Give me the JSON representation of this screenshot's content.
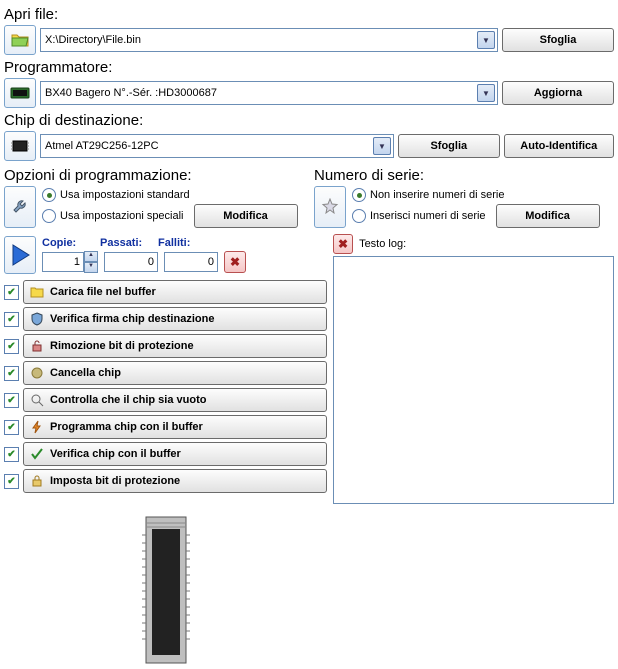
{
  "open_file": {
    "label": "Apri file:",
    "path": "X:\\Directory\\File.bin",
    "browse": "Sfoglia"
  },
  "programmer": {
    "label": "Programmatore:",
    "device": "BX40 Bagero N°.-Sér. :HD3000687",
    "refresh": "Aggiorna"
  },
  "target_chip": {
    "label": "Chip di destinazione:",
    "chip": "Atmel AT29C256-12PC",
    "browse": "Sfoglia",
    "auto": "Auto-Identifica"
  },
  "prog_options": {
    "label": "Opzioni di programmazione:",
    "opt1": "Usa impostazioni standard",
    "opt2": "Usa impostazioni speciali",
    "edit": "Modifica"
  },
  "serial": {
    "label": "Numero di serie:",
    "opt1": "Non inserire numeri di serie",
    "opt2": "Inserisci numeri di serie",
    "edit": "Modifica"
  },
  "run": {
    "copies_label": "Copie:",
    "passed_label": "Passati:",
    "failed_label": "Falliti:",
    "copies": "1",
    "passed": "0",
    "failed": "0"
  },
  "steps": [
    "Carica file nel buffer",
    "Verifica firma chip destinazione",
    "Rimozione bit di protezione",
    "Cancella chip",
    "Controlla che il chip sia vuoto",
    "Programma chip con il buffer",
    "Verifica chip con il buffer",
    "Imposta bit di protezione"
  ],
  "log": {
    "label": "Testo log:"
  }
}
